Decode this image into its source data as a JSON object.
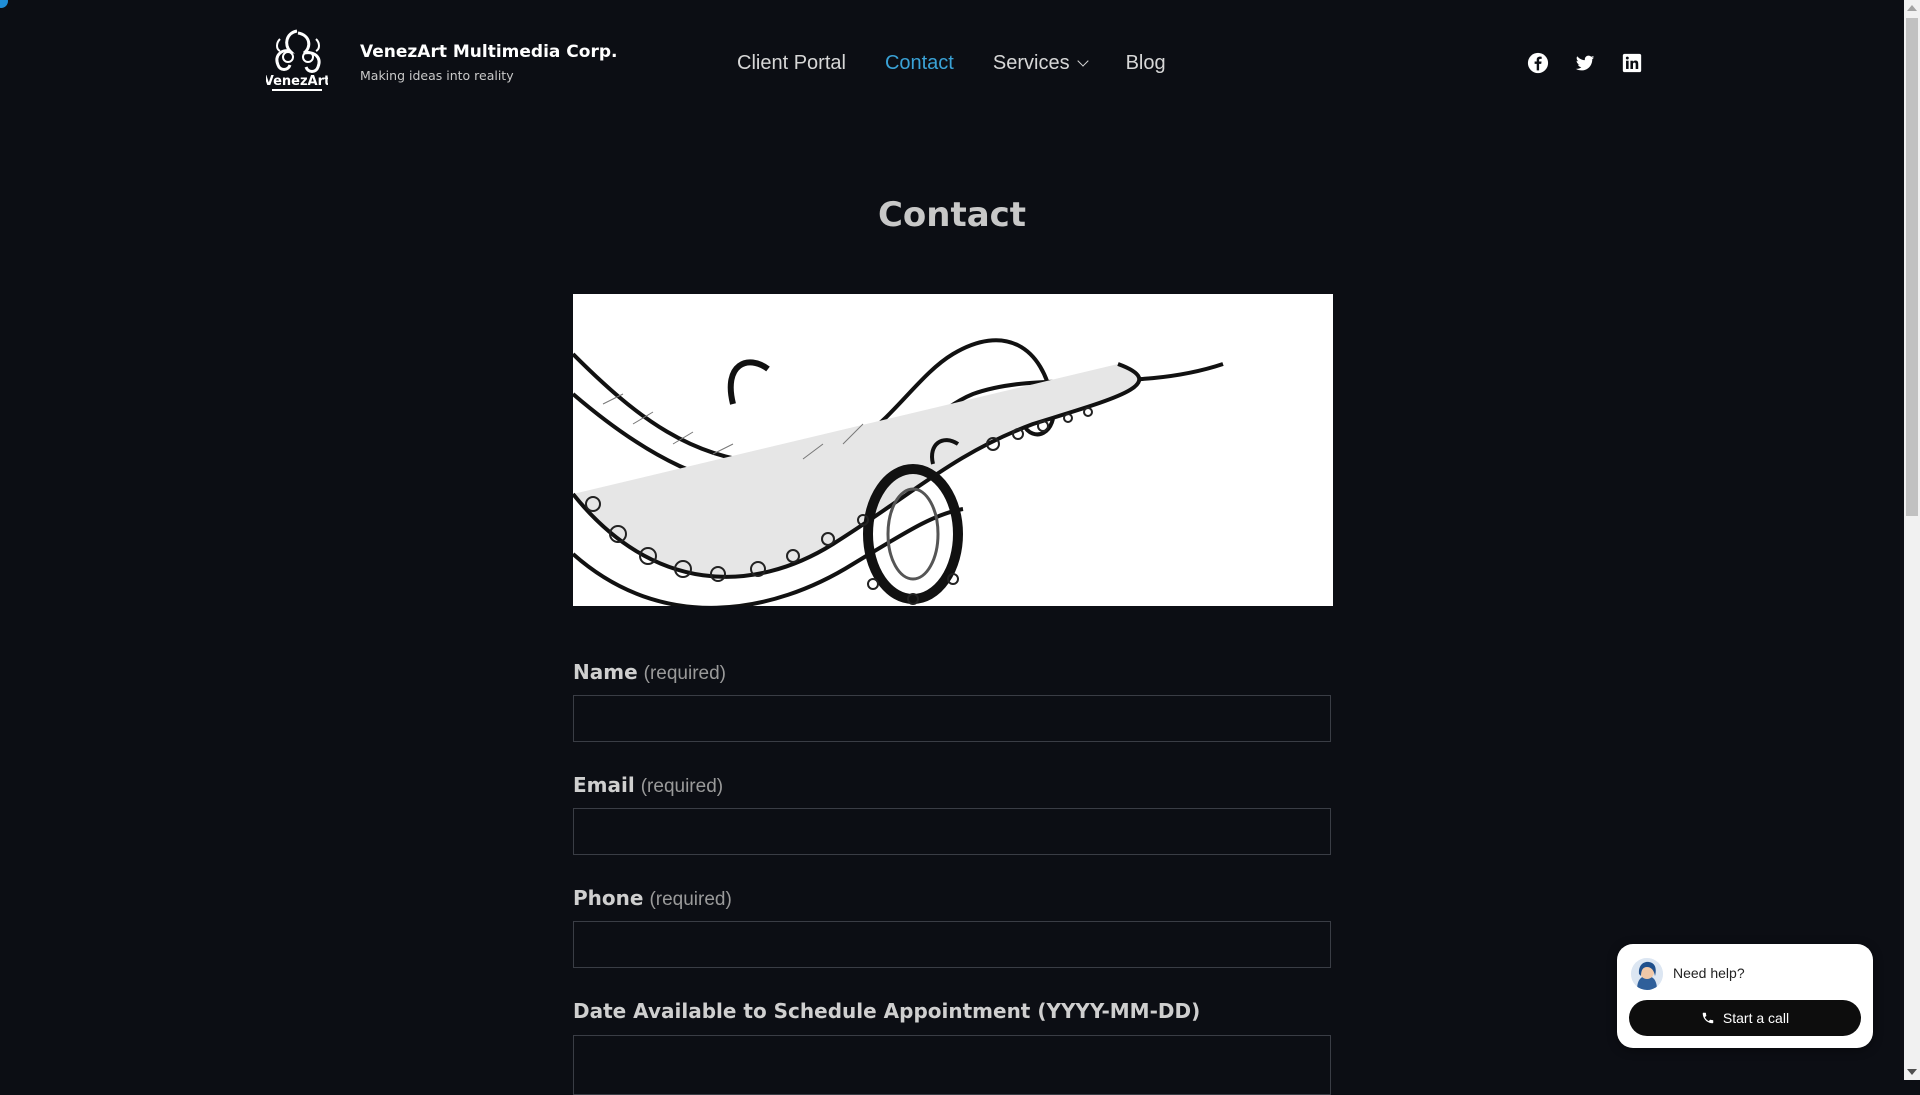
{
  "site": {
    "name": "VenezArt Multimedia Corp.",
    "tagline": "Making ideas into reality",
    "logo_text": "VenezArt"
  },
  "nav": {
    "items": [
      {
        "label": "Client Portal",
        "active": false
      },
      {
        "label": "Contact",
        "active": true
      },
      {
        "label": "Services",
        "active": false,
        "has_dropdown": true
      },
      {
        "label": "Blog",
        "active": false
      }
    ]
  },
  "socials": [
    {
      "icon": "facebook-icon"
    },
    {
      "icon": "twitter-icon"
    },
    {
      "icon": "linkedin-icon"
    }
  ],
  "page": {
    "title": "Contact",
    "hero_image": "octopus-tentacles-illustration"
  },
  "form": {
    "fields": [
      {
        "label": "Name",
        "required_text": "(required)",
        "value": ""
      },
      {
        "label": "Email",
        "required_text": "(required)",
        "value": ""
      },
      {
        "label": "Phone",
        "required_text": "(required)",
        "value": ""
      },
      {
        "label": "Date Available to Schedule Appointment (YYYY-MM-DD)",
        "required_text": "",
        "value": ""
      }
    ]
  },
  "help_widget": {
    "prompt": "Need help?",
    "button_label": "Start a call",
    "button_icon": "phone-icon"
  },
  "colors": {
    "background": "#0c0e14",
    "accent": "#3aa2d6",
    "text": "#d7d7d7"
  }
}
